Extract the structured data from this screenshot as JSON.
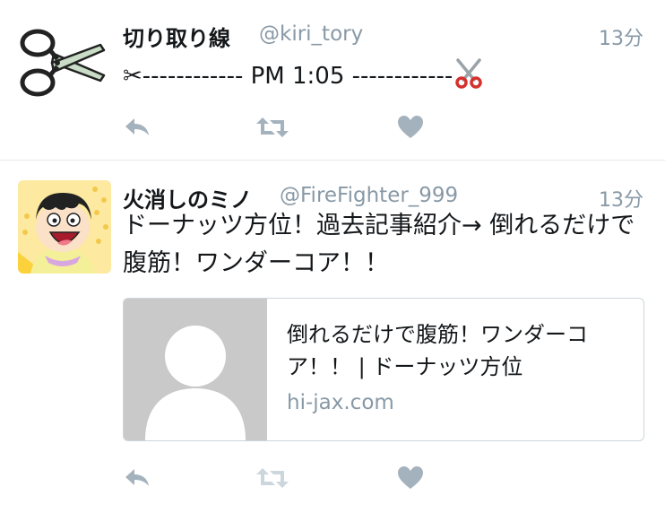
{
  "tweets": [
    {
      "name": "切り取り線",
      "handle": "@kiri_tory",
      "time": "13分",
      "text_prefix": "✂------------ PM 1:05 ------------",
      "avatar_icon": "scissors-icon"
    },
    {
      "name": "火消しのミノ",
      "handle": "@FireFighter_999",
      "time": "13分",
      "text": "ドーナッツ方位！過去記事紹介→ 倒れるだけで腹筋！ワンダーコア！！",
      "avatar_icon": "cartoon-character-avatar",
      "card": {
        "title": "倒れるだけで腹筋！ワンダーコア！！ | ドーナッツ方位",
        "domain": "hi-jax.com",
        "image_icon": "placeholder-person-icon"
      }
    }
  ],
  "actions": {
    "reply_icon": "reply-icon",
    "retweet_icon": "retweet-icon",
    "like_icon": "heart-icon"
  },
  "colors": {
    "text": "#14171a",
    "muted": "#8899a6",
    "action": "#a4b2bd",
    "divider": "#e1e8ed",
    "avatar_bg": "#fde9a0",
    "card_placeholder": "#c9c9c9",
    "scissor_red": "#d4302c"
  }
}
